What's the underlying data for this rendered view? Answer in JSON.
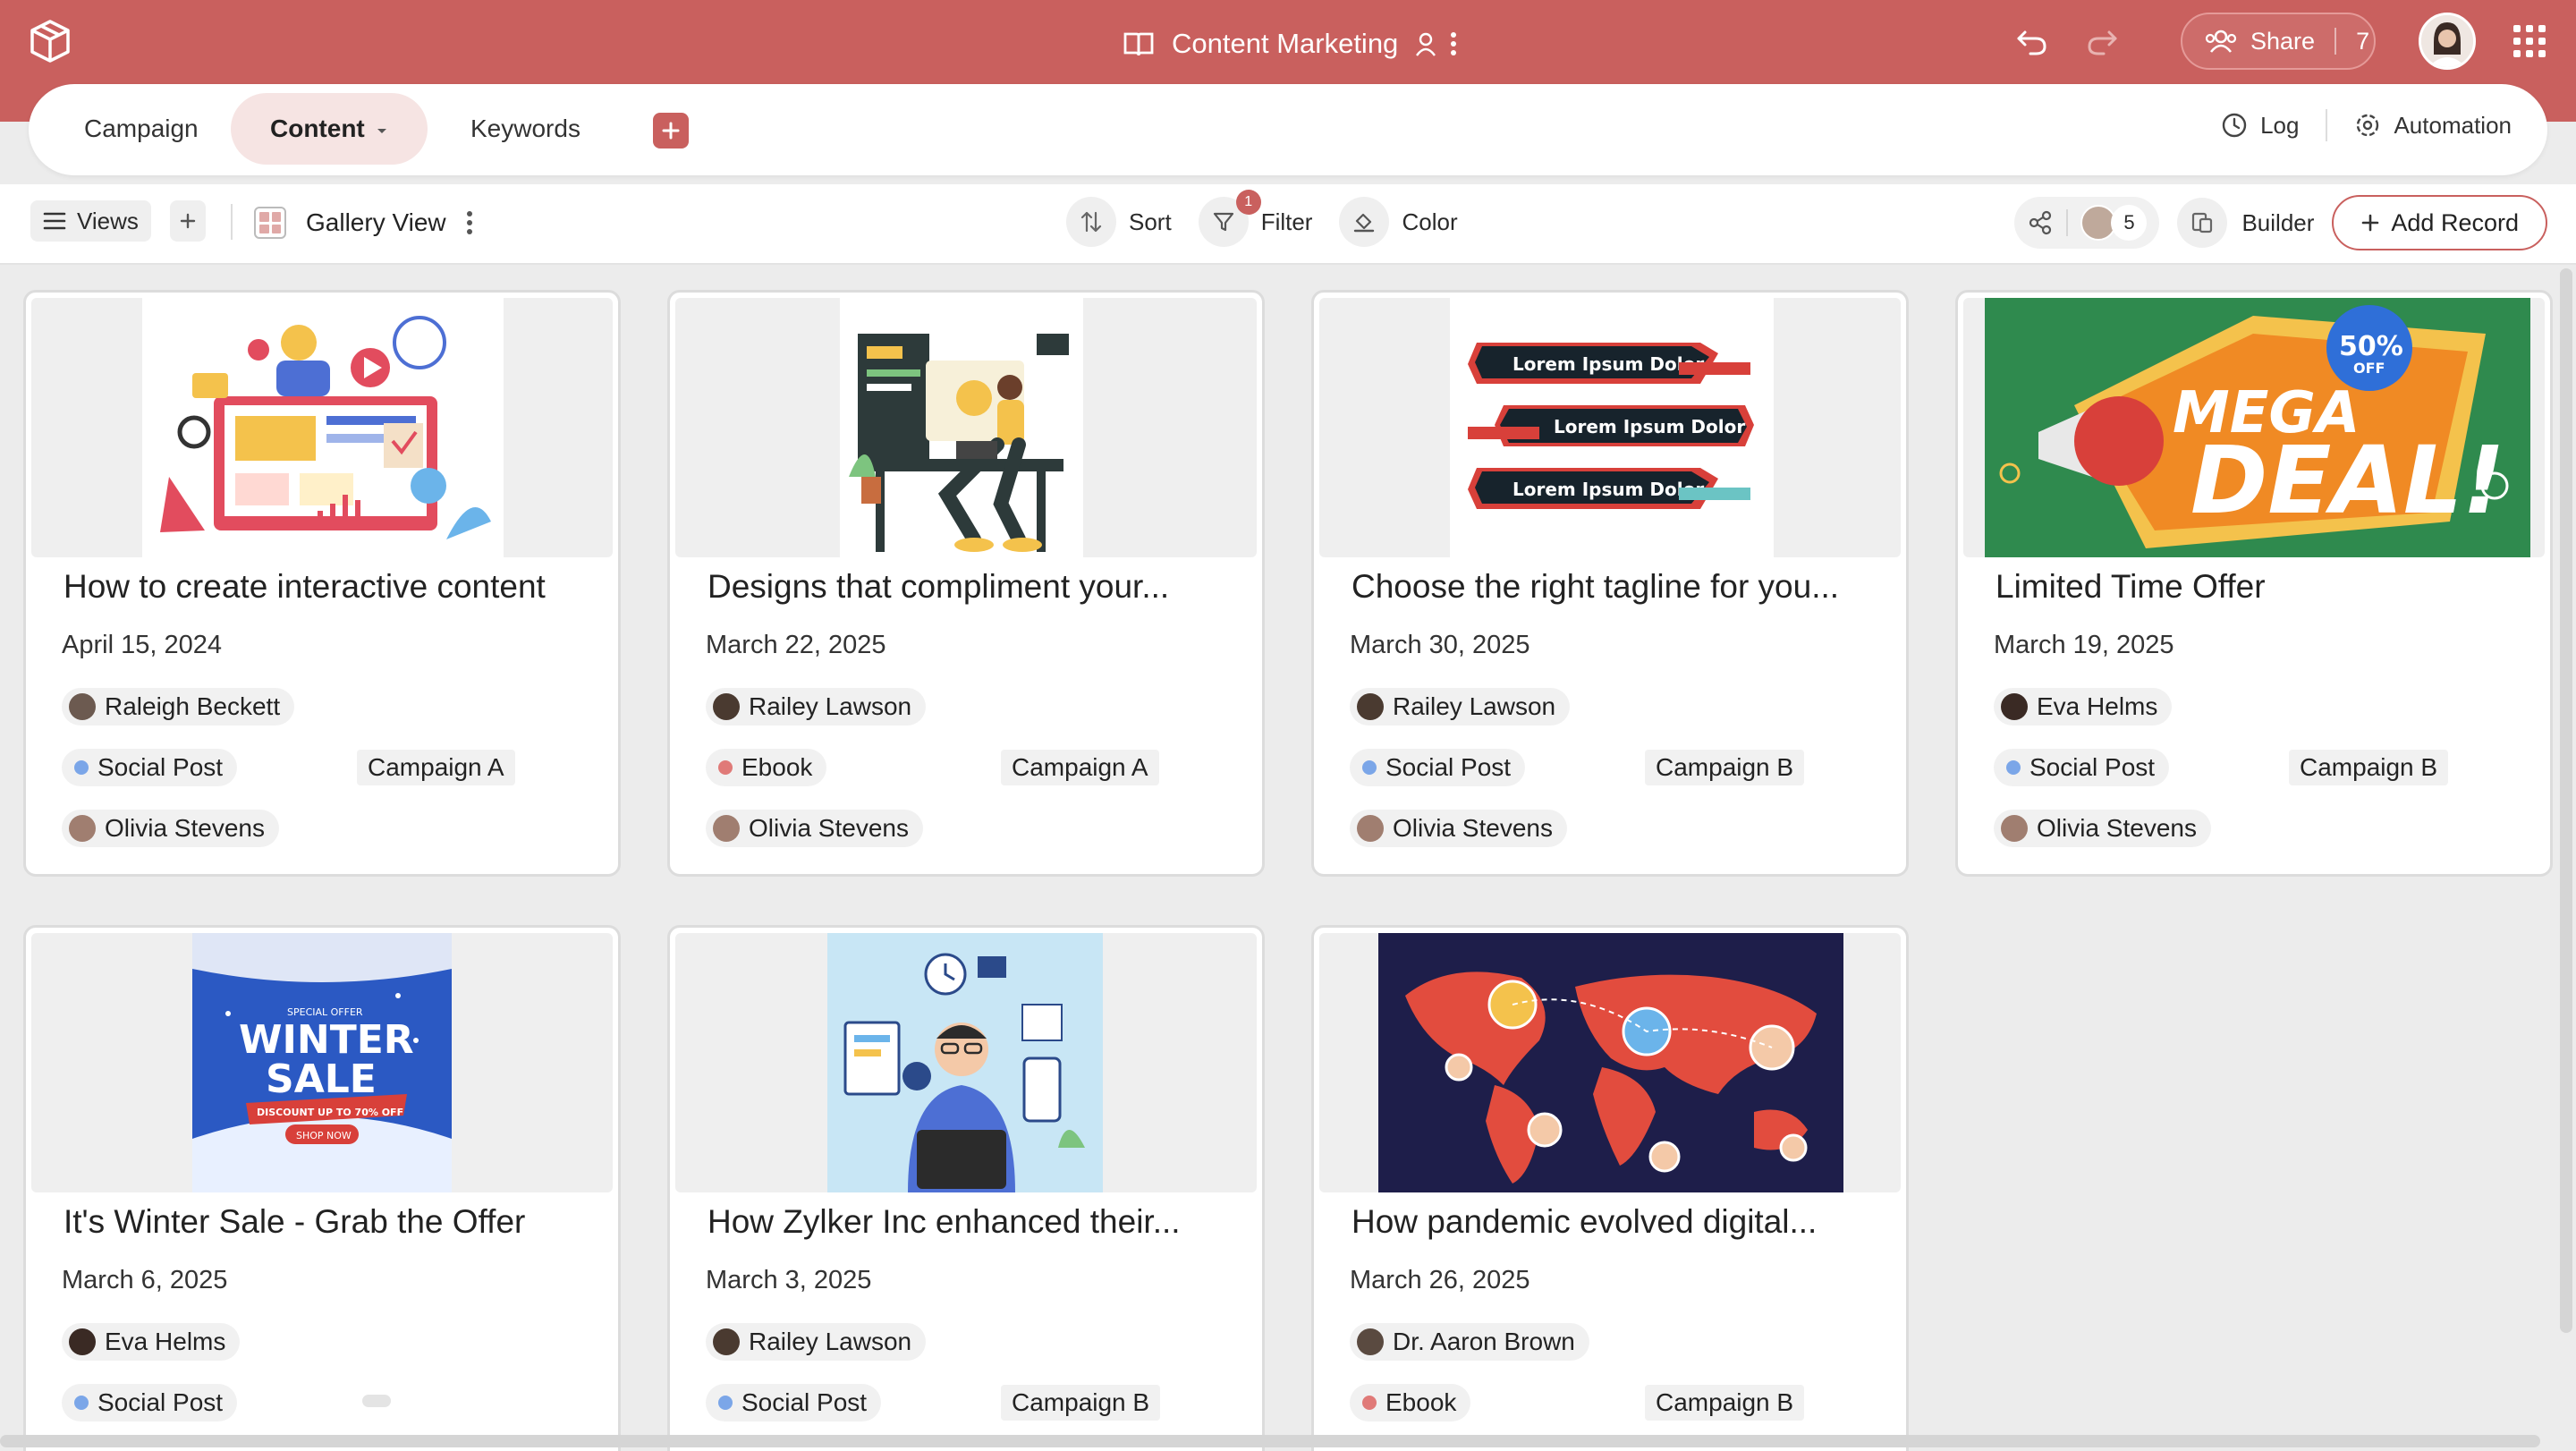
{
  "app": {
    "title": "Content Marketing",
    "share_label": "Share",
    "share_count": "7"
  },
  "tabs": [
    {
      "label": "Campaign"
    },
    {
      "label": "Content"
    },
    {
      "label": "Keywords"
    }
  ],
  "header_tools": {
    "log_label": "Log",
    "automation_label": "Automation"
  },
  "toolbar": {
    "views_label": "Views",
    "view_name": "Gallery View",
    "sort_label": "Sort",
    "filter_label": "Filter",
    "filter_count": "1",
    "color_label": "Color",
    "collaborator_count": "5",
    "builder_label": "Builder",
    "add_record_label": "Add Record"
  },
  "colors": {
    "brand": "#c9605e",
    "social_post": "#7ba6e8",
    "ebook": "#e07a78"
  },
  "cards": [
    {
      "title": "How to create interactive content",
      "date": "April 15, 2024",
      "author": "Raleigh Beckett",
      "type": "Social Post",
      "type_color": "#7ba6e8",
      "campaign": "Campaign A",
      "owner": "Olivia Stevens"
    },
    {
      "title": "Designs that compliment your...",
      "date": "March 22, 2025",
      "author": "Railey Lawson",
      "type": "Ebook",
      "type_color": "#e07a78",
      "campaign": "Campaign A",
      "owner": "Olivia Stevens"
    },
    {
      "title": "Choose the right tagline for you...",
      "date": "March 30, 2025",
      "author": "Railey Lawson",
      "type": "Social Post",
      "type_color": "#7ba6e8",
      "campaign": "Campaign B",
      "owner": "Olivia Stevens"
    },
    {
      "title": "Limited Time Offer",
      "date": "March 19, 2025",
      "author": "Eva Helms",
      "type": "Social Post",
      "type_color": "#7ba6e8",
      "campaign": "Campaign B",
      "owner": "Olivia Stevens"
    },
    {
      "title": "It's Winter Sale - Grab the Offer",
      "date": "March 6, 2025",
      "author": "Eva Helms",
      "type": "Social Post",
      "type_color": "#7ba6e8",
      "campaign": "",
      "owner": ""
    },
    {
      "title": "How Zylker Inc enhanced their...",
      "date": "March 3, 2025",
      "author": "Railey Lawson",
      "type": "Social Post",
      "type_color": "#7ba6e8",
      "campaign": "Campaign B",
      "owner": ""
    },
    {
      "title": "How pandemic evolved digital...",
      "date": "March 26, 2025",
      "author": "Dr. Aaron Brown",
      "type": "Ebook",
      "type_color": "#e07a78",
      "campaign": "Campaign B",
      "owner": ""
    }
  ],
  "image_text": {
    "tagline": "Lorem Ipsum Dolor",
    "mega": "MEGA",
    "deal": "DEAL!",
    "discount": "50%",
    "off": "OFF",
    "special_offer": "SPECIAL OFFER",
    "winter": "WINTER",
    "sale": "SALE",
    "discount_line": "DISCOUNT UP TO 70% OFF",
    "shop_now": "SHOP NOW"
  }
}
